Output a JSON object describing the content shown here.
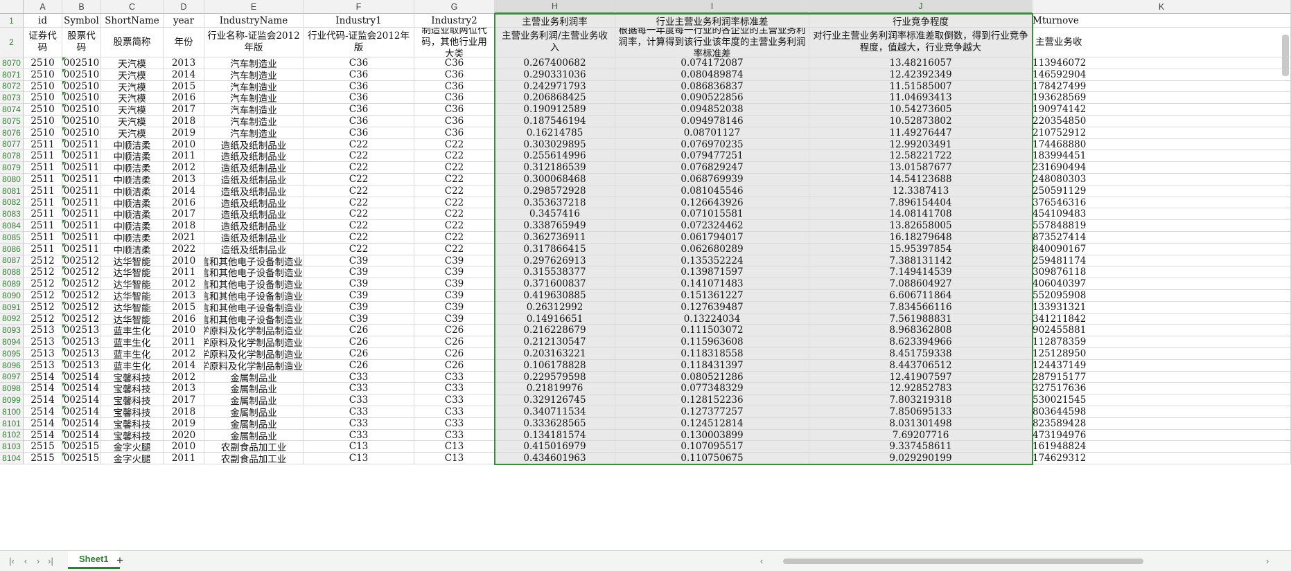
{
  "columns": [
    {
      "letter": "A",
      "field": "id",
      "desc": "证券代码"
    },
    {
      "letter": "B",
      "field": "Symbol",
      "desc": "股票代码"
    },
    {
      "letter": "C",
      "field": "ShortName",
      "desc": "股票简称"
    },
    {
      "letter": "D",
      "field": "year",
      "desc": "年份"
    },
    {
      "letter": "E",
      "field": "IndustryName",
      "desc": "行业名称-证监会2012年版"
    },
    {
      "letter": "F",
      "field": "Industry1",
      "desc": "行业代码-证监会2012年版"
    },
    {
      "letter": "G",
      "field": "Industry2",
      "desc": "制造业取两位代码，其他行业用大类"
    },
    {
      "letter": "H",
      "field": "主营业务利润率",
      "desc": "主营业务利润/主营业务收入"
    },
    {
      "letter": "I",
      "field": "行业主营业务利润率标准差",
      "desc": "根据每一年度每一行业的各企业的主营业务利润率，计算得到该行业该年度的主营业务利润率标准差"
    },
    {
      "letter": "J",
      "field": "行业竞争程度",
      "desc": "对行业主营业务利润率标准差取倒数，得到行业竞争程度，值越大，行业竞争越大"
    },
    {
      "letter": "K",
      "field": "Mturnove",
      "desc": "主营业务收"
    }
  ],
  "header_row_numbers": [
    "1",
    "2"
  ],
  "rows": [
    {
      "n": "8070",
      "id": "2510",
      "sym": "002510",
      "name": "天汽模",
      "year": "2013",
      "ind": "汽车制造业",
      "i1": "C36",
      "i2": "C36",
      "h": "0.267400682",
      "i": "0.074172087",
      "j": "13.48216057",
      "k": "113946072"
    },
    {
      "n": "8071",
      "id": "2510",
      "sym": "002510",
      "name": "天汽模",
      "year": "2014",
      "ind": "汽车制造业",
      "i1": "C36",
      "i2": "C36",
      "h": "0.290331036",
      "i": "0.080489874",
      "j": "12.42392349",
      "k": "146592904"
    },
    {
      "n": "8072",
      "id": "2510",
      "sym": "002510",
      "name": "天汽模",
      "year": "2015",
      "ind": "汽车制造业",
      "i1": "C36",
      "i2": "C36",
      "h": "0.242971793",
      "i": "0.086836837",
      "j": "11.51585007",
      "k": "178427499"
    },
    {
      "n": "8073",
      "id": "2510",
      "sym": "002510",
      "name": "天汽模",
      "year": "2016",
      "ind": "汽车制造业",
      "i1": "C36",
      "i2": "C36",
      "h": "0.206868425",
      "i": "0.090522856",
      "j": "11.04693413",
      "k": "193628569"
    },
    {
      "n": "8074",
      "id": "2510",
      "sym": "002510",
      "name": "天汽模",
      "year": "2017",
      "ind": "汽车制造业",
      "i1": "C36",
      "i2": "C36",
      "h": "0.190912589",
      "i": "0.094852038",
      "j": "10.54273605",
      "k": "190974142"
    },
    {
      "n": "8075",
      "id": "2510",
      "sym": "002510",
      "name": "天汽模",
      "year": "2018",
      "ind": "汽车制造业",
      "i1": "C36",
      "i2": "C36",
      "h": "0.187546194",
      "i": "0.094978146",
      "j": "10.52873802",
      "k": "220354850"
    },
    {
      "n": "8076",
      "id": "2510",
      "sym": "002510",
      "name": "天汽模",
      "year": "2019",
      "ind": "汽车制造业",
      "i1": "C36",
      "i2": "C36",
      "h": "0.16214785",
      "i": "0.08701127",
      "j": "11.49276447",
      "k": "210752912"
    },
    {
      "n": "8077",
      "id": "2511",
      "sym": "002511",
      "name": "中顺洁柔",
      "year": "2010",
      "ind": "造纸及纸制品业",
      "i1": "C22",
      "i2": "C22",
      "h": "0.303029895",
      "i": "0.076970235",
      "j": "12.99203491",
      "k": "174468880"
    },
    {
      "n": "8078",
      "id": "2511",
      "sym": "002511",
      "name": "中顺洁柔",
      "year": "2011",
      "ind": "造纸及纸制品业",
      "i1": "C22",
      "i2": "C22",
      "h": "0.255614996",
      "i": "0.079477251",
      "j": "12.58221722",
      "k": "183994451"
    },
    {
      "n": "8079",
      "id": "2511",
      "sym": "002511",
      "name": "中顺洁柔",
      "year": "2012",
      "ind": "造纸及纸制品业",
      "i1": "C22",
      "i2": "C22",
      "h": "0.312186539",
      "i": "0.076829247",
      "j": "13.01587677",
      "k": "231690494"
    },
    {
      "n": "8080",
      "id": "2511",
      "sym": "002511",
      "name": "中顺洁柔",
      "year": "2013",
      "ind": "造纸及纸制品业",
      "i1": "C22",
      "i2": "C22",
      "h": "0.300068468",
      "i": "0.068769939",
      "j": "14.54123688",
      "k": "248080303"
    },
    {
      "n": "8081",
      "id": "2511",
      "sym": "002511",
      "name": "中顺洁柔",
      "year": "2014",
      "ind": "造纸及纸制品业",
      "i1": "C22",
      "i2": "C22",
      "h": "0.298572928",
      "i": "0.081045546",
      "j": "12.3387413",
      "k": "250591129"
    },
    {
      "n": "8082",
      "id": "2511",
      "sym": "002511",
      "name": "中顺洁柔",
      "year": "2016",
      "ind": "造纸及纸制品业",
      "i1": "C22",
      "i2": "C22",
      "h": "0.353637218",
      "i": "0.126643926",
      "j": "7.896154404",
      "k": "376546316"
    },
    {
      "n": "8083",
      "id": "2511",
      "sym": "002511",
      "name": "中顺洁柔",
      "year": "2017",
      "ind": "造纸及纸制品业",
      "i1": "C22",
      "i2": "C22",
      "h": "0.3457416",
      "i": "0.071015581",
      "j": "14.08141708",
      "k": "454109483"
    },
    {
      "n": "8084",
      "id": "2511",
      "sym": "002511",
      "name": "中顺洁柔",
      "year": "2018",
      "ind": "造纸及纸制品业",
      "i1": "C22",
      "i2": "C22",
      "h": "0.338765949",
      "i": "0.072324462",
      "j": "13.82658005",
      "k": "557848819"
    },
    {
      "n": "8085",
      "id": "2511",
      "sym": "002511",
      "name": "中顺洁柔",
      "year": "2021",
      "ind": "造纸及纸制品业",
      "i1": "C22",
      "i2": "C22",
      "h": "0.362736911",
      "i": "0.061794017",
      "j": "16.18279648",
      "k": "873527414"
    },
    {
      "n": "8086",
      "id": "2511",
      "sym": "002511",
      "name": "中顺洁柔",
      "year": "2022",
      "ind": "造纸及纸制品业",
      "i1": "C22",
      "i2": "C22",
      "h": "0.317866415",
      "i": "0.062680289",
      "j": "15.95397854",
      "k": "840090167"
    },
    {
      "n": "8087",
      "id": "2512",
      "sym": "002512",
      "name": "达华智能",
      "year": "2010",
      "ind": "计算机、通信和其他电子设备制造业",
      "i1": "C39",
      "i2": "C39",
      "h": "0.297626913",
      "i": "0.135352224",
      "j": "7.388131142",
      "k": "259481174"
    },
    {
      "n": "8088",
      "id": "2512",
      "sym": "002512",
      "name": "达华智能",
      "year": "2011",
      "ind": "计算机、通信和其他电子设备制造业",
      "i1": "C39",
      "i2": "C39",
      "h": "0.315538377",
      "i": "0.139871597",
      "j": "7.149414539",
      "k": "309876118"
    },
    {
      "n": "8089",
      "id": "2512",
      "sym": "002512",
      "name": "达华智能",
      "year": "2012",
      "ind": "计算机、通信和其他电子设备制造业",
      "i1": "C39",
      "i2": "C39",
      "h": "0.371600837",
      "i": "0.141071483",
      "j": "7.088604927",
      "k": "406040397"
    },
    {
      "n": "8090",
      "id": "2512",
      "sym": "002512",
      "name": "达华智能",
      "year": "2013",
      "ind": "计算机、通信和其他电子设备制造业",
      "i1": "C39",
      "i2": "C39",
      "h": "0.419630885",
      "i": "0.151361227",
      "j": "6.606711864",
      "k": "552095908"
    },
    {
      "n": "8091",
      "id": "2512",
      "sym": "002512",
      "name": "达华智能",
      "year": "2015",
      "ind": "计算机、通信和其他电子设备制造业",
      "i1": "C39",
      "i2": "C39",
      "h": "0.26312992",
      "i": "0.127639487",
      "j": "7.834566116",
      "k": "133931321"
    },
    {
      "n": "8092",
      "id": "2512",
      "sym": "002512",
      "name": "达华智能",
      "year": "2016",
      "ind": "计算机、通信和其他电子设备制造业",
      "i1": "C39",
      "i2": "C39",
      "h": "0.14916651",
      "i": "0.13224034",
      "j": "7.561988831",
      "k": "341211842"
    },
    {
      "n": "8093",
      "id": "2513",
      "sym": "002513",
      "name": "蓝丰生化",
      "year": "2010",
      "ind": "化学原料及化学制品制造业",
      "i1": "C26",
      "i2": "C26",
      "h": "0.216228679",
      "i": "0.111503072",
      "j": "8.968362808",
      "k": "902455881"
    },
    {
      "n": "8094",
      "id": "2513",
      "sym": "002513",
      "name": "蓝丰生化",
      "year": "2011",
      "ind": "化学原料及化学制品制造业",
      "i1": "C26",
      "i2": "C26",
      "h": "0.212130547",
      "i": "0.115963608",
      "j": "8.623394966",
      "k": "112878359"
    },
    {
      "n": "8095",
      "id": "2513",
      "sym": "002513",
      "name": "蓝丰生化",
      "year": "2012",
      "ind": "化学原料及化学制品制造业",
      "i1": "C26",
      "i2": "C26",
      "h": "0.203163221",
      "i": "0.118318558",
      "j": "8.451759338",
      "k": "125128950"
    },
    {
      "n": "8096",
      "id": "2513",
      "sym": "002513",
      "name": "蓝丰生化",
      "year": "2014",
      "ind": "化学原料及化学制品制造业",
      "i1": "C26",
      "i2": "C26",
      "h": "0.106178828",
      "i": "0.118431397",
      "j": "8.443706512",
      "k": "124437149"
    },
    {
      "n": "8097",
      "id": "2514",
      "sym": "002514",
      "name": "宝馨科技",
      "year": "2012",
      "ind": "金属制品业",
      "i1": "C33",
      "i2": "C33",
      "h": "0.229579598",
      "i": "0.080521286",
      "j": "12.41907597",
      "k": "287915177"
    },
    {
      "n": "8098",
      "id": "2514",
      "sym": "002514",
      "name": "宝馨科技",
      "year": "2013",
      "ind": "金属制品业",
      "i1": "C33",
      "i2": "C33",
      "h": "0.21819976",
      "i": "0.077348329",
      "j": "12.92852783",
      "k": "327517636"
    },
    {
      "n": "8099",
      "id": "2514",
      "sym": "002514",
      "name": "宝馨科技",
      "year": "2017",
      "ind": "金属制品业",
      "i1": "C33",
      "i2": "C33",
      "h": "0.329126745",
      "i": "0.128152236",
      "j": "7.803219318",
      "k": "530021545"
    },
    {
      "n": "8100",
      "id": "2514",
      "sym": "002514",
      "name": "宝馨科技",
      "year": "2018",
      "ind": "金属制品业",
      "i1": "C33",
      "i2": "C33",
      "h": "0.340711534",
      "i": "0.127377257",
      "j": "7.850695133",
      "k": "803644598"
    },
    {
      "n": "8101",
      "id": "2514",
      "sym": "002514",
      "name": "宝馨科技",
      "year": "2019",
      "ind": "金属制品业",
      "i1": "C33",
      "i2": "C33",
      "h": "0.333628565",
      "i": "0.124512814",
      "j": "8.031301498",
      "k": "823589428"
    },
    {
      "n": "8102",
      "id": "2514",
      "sym": "002514",
      "name": "宝馨科技",
      "year": "2020",
      "ind": "金属制品业",
      "i1": "C33",
      "i2": "C33",
      "h": "0.134181574",
      "i": "0.130003899",
      "j": "7.69207716",
      "k": "473194976"
    },
    {
      "n": "8103",
      "id": "2515",
      "sym": "002515",
      "name": "金字火腿",
      "year": "2010",
      "ind": "农副食品加工业",
      "i1": "C13",
      "i2": "C13",
      "h": "0.415016979",
      "i": "0.107095517",
      "j": "9.337458611",
      "k": "161948824"
    },
    {
      "n": "8104",
      "id": "2515",
      "sym": "002515",
      "name": "金字火腿",
      "year": "2011",
      "ind": "农副食品加工业",
      "i1": "C13",
      "i2": "C13",
      "h": "0.434601963",
      "i": "0.110750675",
      "j": "9.029290199",
      "k": "174629312"
    }
  ],
  "statusbar": {
    "nav_first": "|‹",
    "nav_prev": "‹",
    "nav_next": "›",
    "nav_last": "›|",
    "sheet_tab": "Sheet1",
    "add_sheet": "+",
    "scroll_left": "‹",
    "scroll_right": "›"
  },
  "colors": {
    "accent": "#3c8c3c",
    "selection_fill": "#e9e9e9",
    "header_fill": "#f2f2f2"
  }
}
